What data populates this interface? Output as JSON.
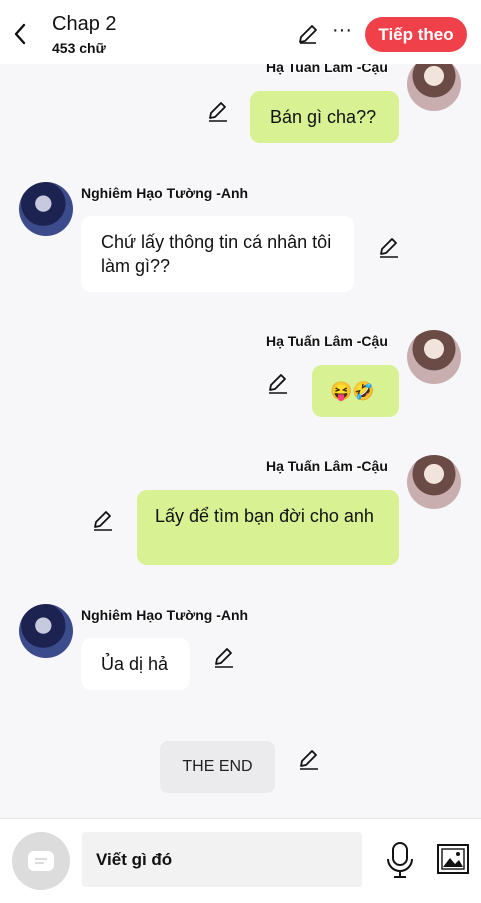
{
  "header": {
    "title": "Chap 2",
    "word_count": "453 chữ",
    "next_label": "Tiếp theo"
  },
  "messages": [
    {
      "sender": "Hạ Tuấn Lâm -Cậu",
      "text": "Bán gì cha??",
      "side": "right"
    },
    {
      "sender": "Nghiêm Hạo Tường -Anh",
      "text": "Chứ lấy thông tin cá nhân tôi làm gì??",
      "side": "left"
    },
    {
      "sender": "Hạ Tuấn Lâm -Cậu",
      "text": "😝🤣",
      "side": "right"
    },
    {
      "sender": "Hạ Tuấn Lâm -Cậu",
      "text": "Lấy để tìm bạn đời cho anh",
      "side": "right"
    },
    {
      "sender": "Nghiêm Hạo Tường -Anh",
      "text": "Ủa dị hả",
      "side": "left"
    }
  ],
  "end_label": "THE END",
  "composer": {
    "placeholder": "Viết gì đó"
  },
  "colors": {
    "accent": "#f0414b",
    "bubble_right": "#d7f193",
    "bubble_left": "#ffffff",
    "background": "#f7f7f9"
  },
  "icons": [
    "back-icon",
    "pen-icon",
    "more-icon",
    "chat-icon",
    "mic-icon",
    "image-icon"
  ]
}
